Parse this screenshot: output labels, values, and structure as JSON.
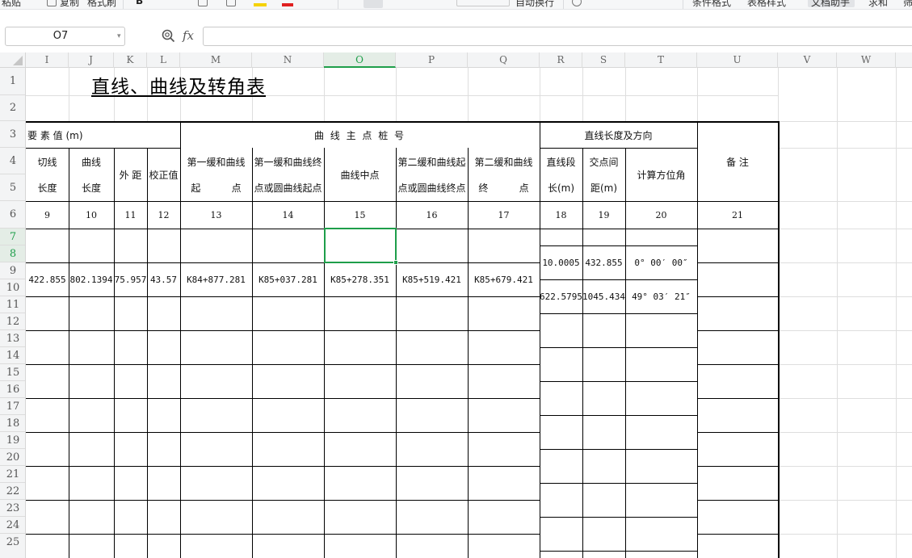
{
  "toolbar": {
    "items": [
      "粘贴",
      "复制",
      "格式刷",
      "自动换行",
      "条件格式",
      "表格样式",
      "文档助手",
      "求和",
      "筛"
    ]
  },
  "formula_bar": {
    "name_box": "O7",
    "fx_label": "fx",
    "formula_value": ""
  },
  "columns": [
    "I",
    "J",
    "K",
    "L",
    "M",
    "N",
    "O",
    "P",
    "Q",
    "R",
    "S",
    "T",
    "U",
    "V",
    "W"
  ],
  "rows": [
    "1",
    "2",
    "3",
    "4",
    "5",
    "6",
    "7",
    "8",
    "9",
    "10",
    "11",
    "12",
    "13",
    "14",
    "15",
    "16",
    "17",
    "18",
    "19",
    "20",
    "21",
    "22",
    "23",
    "24",
    "25"
  ],
  "sheet": {
    "title": "直线、曲线及转角表",
    "group_curve_elements": "要  素  值  (m)",
    "group_main_points": "曲  线  主  点  桩  号",
    "group_straight": "直线长度及方向",
    "remarks": "备  注",
    "h_tangent_1": "切线",
    "h_tangent_2": "长度",
    "h_curve_1": "曲线",
    "h_curve_2": "长度",
    "h_external": "外 距",
    "h_correction": "校正值",
    "h_m_1": "第一缓和曲线",
    "h_m_2": "起          点",
    "h_n_1": "第一缓和曲线终",
    "h_n_2": "点或圆曲线起点",
    "h_mid": "曲线中点",
    "h_p_1": "第二缓和曲线起",
    "h_p_2": "点或圆曲线终点",
    "h_q_1": "第二缓和曲线",
    "h_q_2": "终          点",
    "h_r_1": "直线段",
    "h_r_2": "长(m)",
    "h_s_1": "交点间",
    "h_s_2": "距(m)",
    "h_azimuth": "计算方位角",
    "col_numbers": [
      "9",
      "10",
      "11",
      "12",
      "13",
      "14",
      "15",
      "16",
      "17",
      "18",
      "19",
      "20",
      "21"
    ],
    "data_row": {
      "tangent": "422.855",
      "curve": "802.1394",
      "external": "75.957",
      "correction": "43.57",
      "zh": "K84+877.281",
      "hy": "K85+037.281",
      "qz": "K85+278.351",
      "yh": "K85+519.421",
      "hz": "K85+679.421"
    },
    "straight_rows": [
      {
        "length": "10.0005",
        "distance": "432.855",
        "azimuth": "0° 00′ 00″"
      },
      {
        "length": "622.5795",
        "distance": "1045.434",
        "azimuth": "49° 03′ 21″"
      }
    ]
  },
  "colors": {
    "selection": "#1e9e4a",
    "grid": "#dedede",
    "header_bg": "#f3f4f5"
  }
}
